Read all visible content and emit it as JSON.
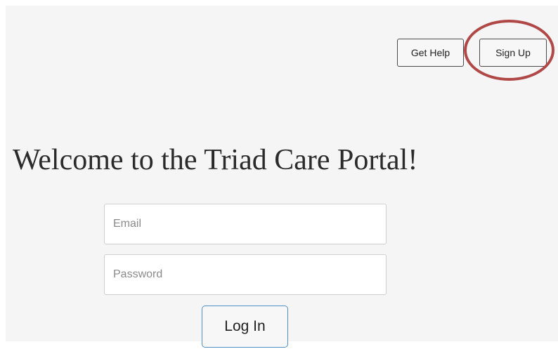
{
  "header": {
    "get_help_label": "Get Help",
    "sign_up_label": "Sign Up"
  },
  "main": {
    "title": "Welcome to the Triad Care Portal!",
    "email_placeholder": "Email",
    "password_placeholder": "Password",
    "login_label": "Log In"
  },
  "annotation": {
    "highlight_color": "#b04848",
    "highlight_target": "sign-up-button"
  }
}
